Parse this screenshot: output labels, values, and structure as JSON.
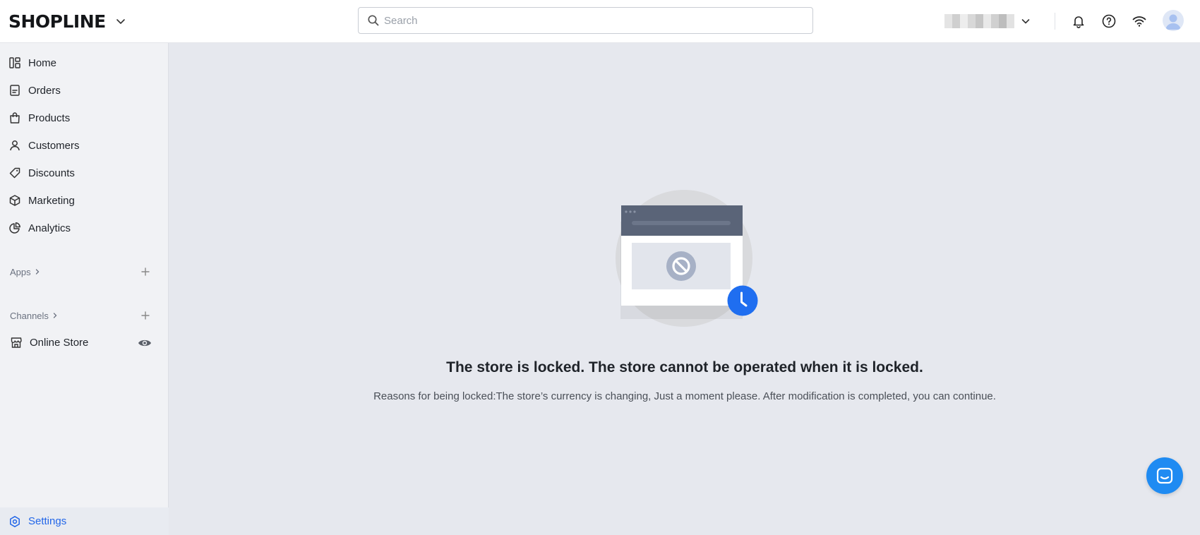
{
  "header": {
    "logo_text": "SHOPLINE",
    "search_placeholder": "Search",
    "store_name_hidden": true
  },
  "sidebar": {
    "items": [
      {
        "label": "Home",
        "icon": "home-icon"
      },
      {
        "label": "Orders",
        "icon": "orders-icon"
      },
      {
        "label": "Products",
        "icon": "bag-icon"
      },
      {
        "label": "Customers",
        "icon": "person-icon"
      },
      {
        "label": "Discounts",
        "icon": "tag-icon"
      },
      {
        "label": "Marketing",
        "icon": "cube-icon"
      },
      {
        "label": "Analytics",
        "icon": "pie-chart-icon"
      }
    ],
    "apps_label": "Apps",
    "channels_label": "Channels",
    "online_store_label": "Online Store",
    "settings_label": "Settings"
  },
  "main": {
    "headline": "The store is locked. The store cannot be operated when it is locked.",
    "reason": "Reasons for being locked:The store’s currency is changing, Just a moment please. After modification is completed, you can continue."
  },
  "colors": {
    "accent": "#2266e8",
    "chat": "#1f8bf2",
    "main_bg": "#e6e8ee",
    "sidebar_bg": "#f1f2f5"
  }
}
